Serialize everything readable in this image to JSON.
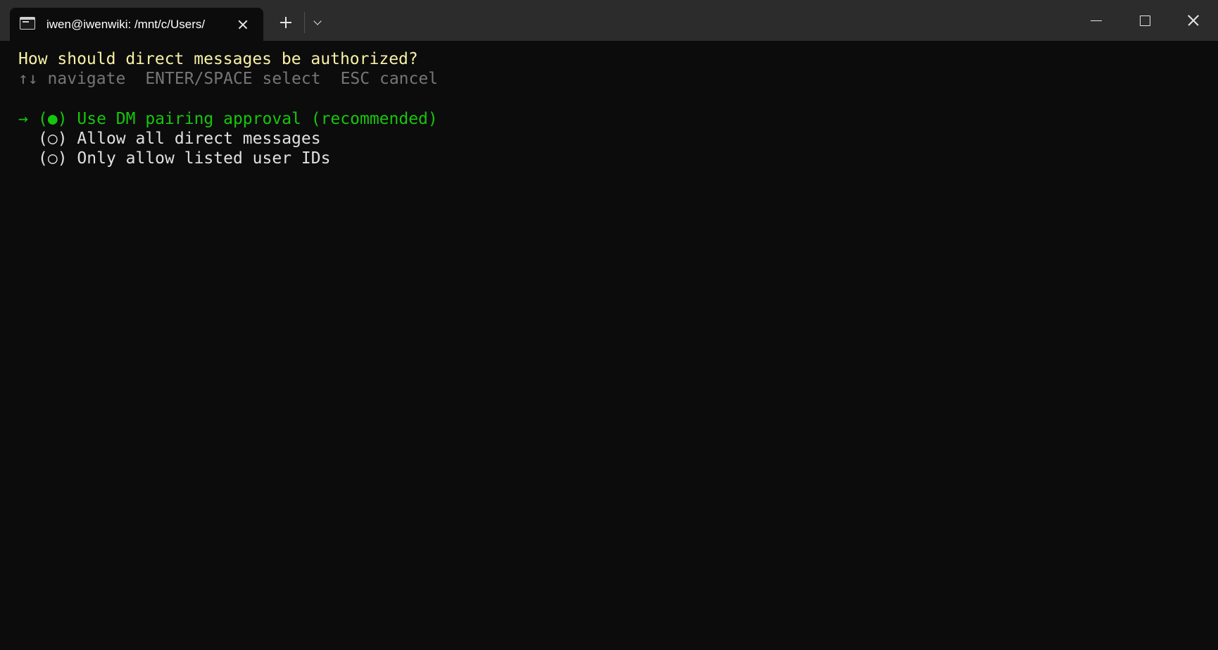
{
  "window": {
    "tab_title": "iwen@iwenwiki: /mnt/c/Users/",
    "tab_icon": "terminal-icon",
    "controls": {
      "new_tab_icon": "plus-icon",
      "dropdown_icon": "chevron-down-icon",
      "minimize_icon": "minimize-icon",
      "maximize_icon": "maximize-icon",
      "close_icon": "close-icon"
    }
  },
  "terminal": {
    "question": "How should direct messages be authorized?",
    "hints": {
      "navigate": "↑↓ navigate",
      "select": "ENTER/SPACE select",
      "cancel": "ESC cancel"
    },
    "pointer": "→",
    "options": [
      {
        "marker": "(●)",
        "label": "Use DM pairing approval (recommended)"
      },
      {
        "marker": "(○)",
        "label": "Allow all direct messages"
      },
      {
        "marker": "(○)",
        "label": "Only allow listed user IDs"
      }
    ]
  },
  "colors": {
    "background": "#0c0c0c",
    "titlebar": "#2c2c2c",
    "question": "#f9f1a5",
    "hint": "#767676",
    "selected": "#16c60c",
    "option": "#e0e0e0"
  }
}
